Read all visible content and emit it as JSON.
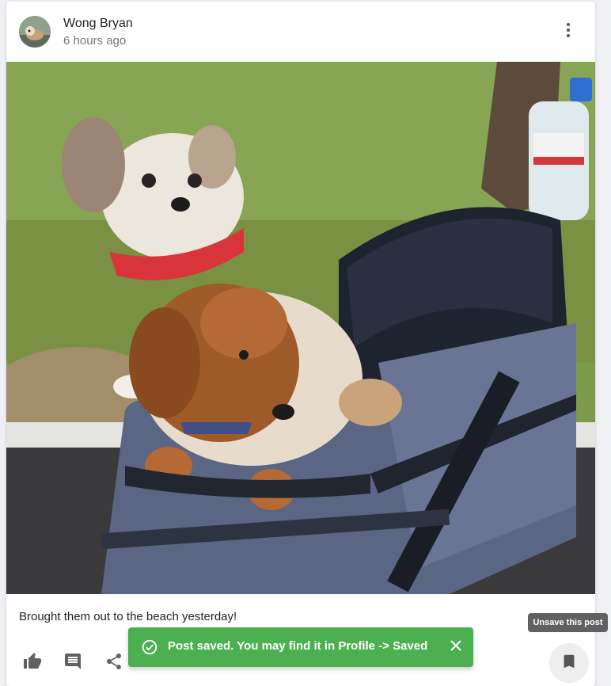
{
  "post": {
    "author": "Wong Bryan",
    "time": "6 hours ago",
    "caption": "Brought them out to the beach yesterday!"
  },
  "actions": {
    "like_icon": "thumb-up-icon",
    "comment_icon": "comment-icon",
    "share_icon": "share-icon",
    "more_icon": "more-vert-icon",
    "save_icon": "bookmark-icon"
  },
  "tooltip": {
    "text": "Unsave this post"
  },
  "snackbar": {
    "message": "Post saved. You may find it in Profile -> Saved",
    "color": "#4caf50"
  },
  "colors": {
    "icon": "#616161",
    "snackbar": "#4caf50",
    "tooltip": "#616161"
  }
}
